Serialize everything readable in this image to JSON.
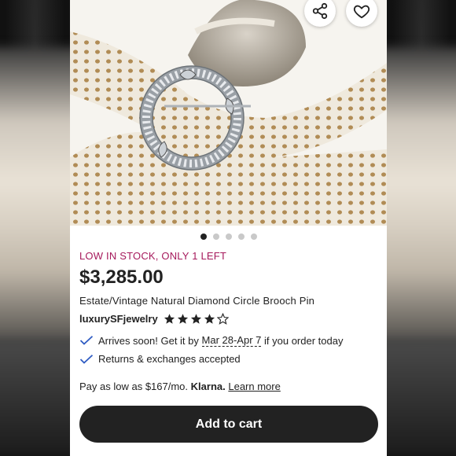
{
  "product": {
    "stock_notice": "LOW IN STOCK, ONLY 1 LEFT",
    "price": "$3,285.00",
    "title": "Estate/Vintage Natural Diamond Circle Brooch Pin",
    "shop_name": "luxurySFjewelry",
    "rating": 4,
    "rating_max": 5
  },
  "photo": {
    "alt": "Diamond circle brooch pin on coral",
    "slide_count": 5,
    "active_slide": 1
  },
  "actions": {
    "share_icon": "share-icon",
    "favorite_icon": "heart-icon"
  },
  "shipping": {
    "arrives_prefix": "Arrives soon! Get it by",
    "arrives_dates": "Mar 28-Apr 7",
    "arrives_suffix": "if you order today",
    "returns": "Returns & exchanges accepted"
  },
  "payment": {
    "pay_text": "Pay as low as $167/mo.",
    "provider": "Klarna.",
    "learn_more": "Learn more"
  },
  "cart": {
    "label": "Add to cart"
  },
  "colors": {
    "stock": "#a61a5c",
    "button": "#222222",
    "check": "#2f5cc3"
  }
}
